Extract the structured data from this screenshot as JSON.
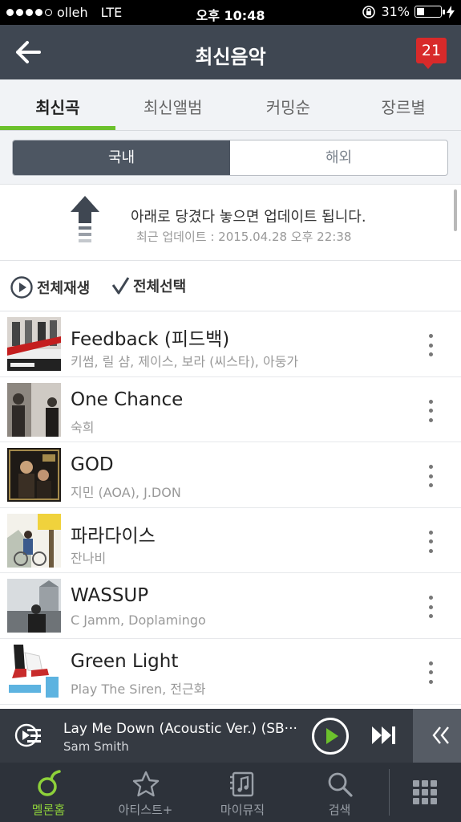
{
  "status_bar": {
    "carrier": "olleh",
    "network": "LTE",
    "time": "오후 10:48",
    "battery": "31%",
    "battery_level": 0.31
  },
  "header": {
    "title": "최신음악",
    "badge_count": "21"
  },
  "tabs": [
    {
      "label": "최신곡",
      "active": true
    },
    {
      "label": "최신앨범",
      "active": false
    },
    {
      "label": "커밍순",
      "active": false
    },
    {
      "label": "장르별",
      "active": false
    }
  ],
  "segment": {
    "domestic": "국내",
    "overseas": "해외",
    "selected": "국내"
  },
  "refresh": {
    "message": "아래로 당겼다 놓으면 업데이트 됩니다.",
    "last_update": "최근 업데이트 : 2015.04.28 오후 22:38"
  },
  "toolbar": {
    "play_all": "전체재생",
    "select_all": "전체선택"
  },
  "songs": [
    {
      "title": "Feedback (피드백)",
      "artist": "키썸, 릴 샴, 제이스, 보라 (씨스타), 아둥가"
    },
    {
      "title": "One Chance",
      "artist": "숙희"
    },
    {
      "title": "GOD",
      "artist": "지민 (AOA), J.DON"
    },
    {
      "title": "파라다이스",
      "artist": "잔나비"
    },
    {
      "title": "WASSUP",
      "artist": "C Jamm, Doplamingo"
    },
    {
      "title": "Green Light",
      "artist": "Play The Siren, 전근화"
    }
  ],
  "mini_player": {
    "title": "Lay Me Down (Acoustic Ver.) (SB···",
    "artist": "Sam Smith"
  },
  "bottom_nav": [
    {
      "label": "멜론홈",
      "icon": "melon-home-icon",
      "active": true
    },
    {
      "label": "아티스트+",
      "icon": "star-icon",
      "active": false
    },
    {
      "label": "마이뮤직",
      "icon": "my-music-icon",
      "active": false
    },
    {
      "label": "검색",
      "icon": "search-icon",
      "active": false
    }
  ],
  "colors": {
    "accent": "#6cc12c",
    "header_bg": "#3f4752",
    "badge": "#d82a2a"
  }
}
